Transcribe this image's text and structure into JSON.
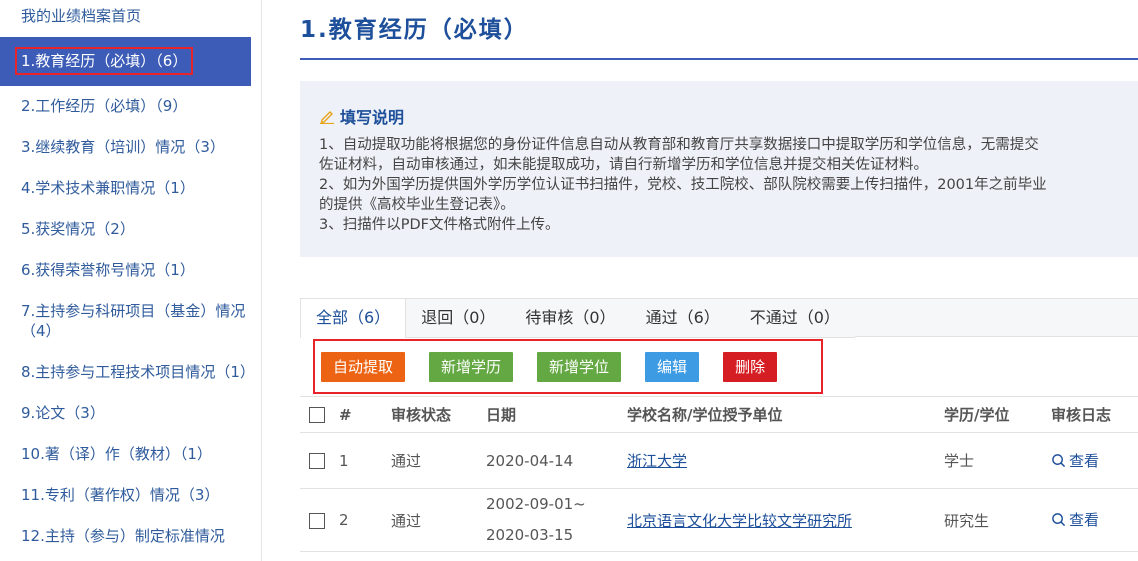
{
  "sidebar": {
    "home": "我的业绩档案首页",
    "items": [
      {
        "label": "1.教育经历（必填）（6）"
      },
      {
        "label": "2.工作经历（必填）（9）"
      },
      {
        "label": "3.继续教育（培训）情况（3）"
      },
      {
        "label": "4.学术技术兼职情况（1）"
      },
      {
        "label": "5.获奖情况（2）"
      },
      {
        "label": "6.获得荣誉称号情况（1）"
      },
      {
        "label": "7.主持参与科研项目（基金）情况（4）"
      },
      {
        "label": "8.主持参与工程技术项目情况（1）"
      },
      {
        "label": "9.论文（3）"
      },
      {
        "label": "10.著（译）作（教材）（1）"
      },
      {
        "label": "11.专利（著作权）情况（3）"
      },
      {
        "label": "12.主持（参与）制定标准情况"
      }
    ]
  },
  "page": {
    "title": "1.教育经历（必填）"
  },
  "notice": {
    "heading": "填写说明",
    "lines": [
      "1、自动提取功能将根据您的身份证件信息自动从教育部和教育厅共享数据接口中提取学历和学位信息，无需提交",
      "佐证材料，自动审核通过，如未能提取成功，请自行新增学历和学位信息并提交相关佐证材料。",
      "2、如为外国学历提供国外学历学位认证书扫描件，党校、技工院校、部队院校需要上传扫描件，2001年之前毕业",
      "的提供《高校毕业生登记表》。",
      "3、扫描件以PDF文件格式附件上传。"
    ]
  },
  "tabs": [
    {
      "label": "全部（6）"
    },
    {
      "label": "退回（0）"
    },
    {
      "label": "待审核（0）"
    },
    {
      "label": "通过（6）"
    },
    {
      "label": "不通过（0）"
    }
  ],
  "toolbar": {
    "auto_extract": "自动提取",
    "add_degree": "新增学历",
    "add_diploma": "新增学位",
    "edit": "编辑",
    "delete": "删除"
  },
  "table": {
    "headers": {
      "index": "#",
      "status": "审核状态",
      "date": "日期",
      "school": "学校名称/学位授予单位",
      "level": "学历/学位",
      "log": "审核日志"
    },
    "rows": [
      {
        "index": "1",
        "status": "通过",
        "date_start": "2020-04-14",
        "date_end": "",
        "school": "浙江大学",
        "level": "学士",
        "view": "查看"
      },
      {
        "index": "2",
        "status": "通过",
        "date_start": "2002-09-01~",
        "date_end": "2020-03-15",
        "school": "北京语言文化大学比较文学研究所",
        "level": "研究生",
        "view": "查看"
      }
    ]
  },
  "colors": {
    "primary": "#3c5cb8",
    "title": "#1d4f9a",
    "highlight": "#e8242a",
    "btn_orange": "#ec6413",
    "btn_green": "#64a843",
    "btn_blue": "#3d9be3",
    "btn_red": "#d51e24"
  }
}
